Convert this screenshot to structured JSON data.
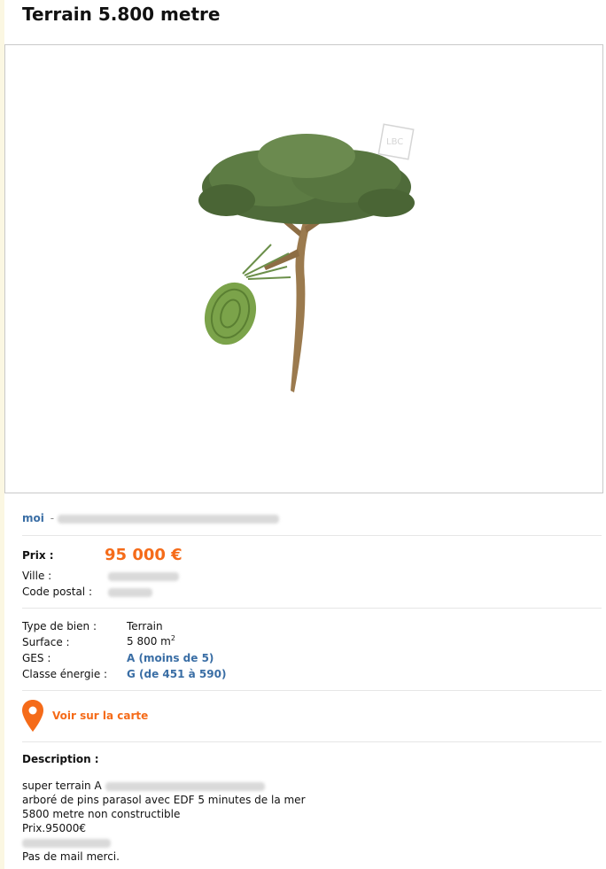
{
  "title": "Terrain 5.800 metre",
  "photo": {
    "icon": "pine-tree-illustration",
    "watermark": "LBC"
  },
  "seller": {
    "name": "moi",
    "separator": "-"
  },
  "price": {
    "label": "Prix :",
    "value": "95 000 €"
  },
  "location": {
    "city_label": "Ville :",
    "postal_label": "Code postal :"
  },
  "criteria": {
    "type_label": "Type de bien :",
    "type_value": "Terrain",
    "surface_label": "Surface :",
    "surface_value": "5 800 m",
    "surface_unit_exp": "2",
    "ges_label": "GES :",
    "ges_value": "A (moins de 5)",
    "energy_label": "Classe énergie :",
    "energy_value": "G (de 451 à 590)"
  },
  "map": {
    "label": "Voir sur la carte",
    "icon": "map-pin-icon"
  },
  "description": {
    "title": "Description :",
    "line1": "super terrain A",
    "line2": "arboré de pins parasol avec EDF 5 minutes de la mer",
    "line3": "5800 metre non constructible",
    "line4": "Prix.95000€",
    "line6": "Pas de mail merci."
  },
  "colors": {
    "accent": "#f56b19",
    "link": "#3a6ea5",
    "divider": "#e6e6e6",
    "strip": "#fbf7e2"
  }
}
